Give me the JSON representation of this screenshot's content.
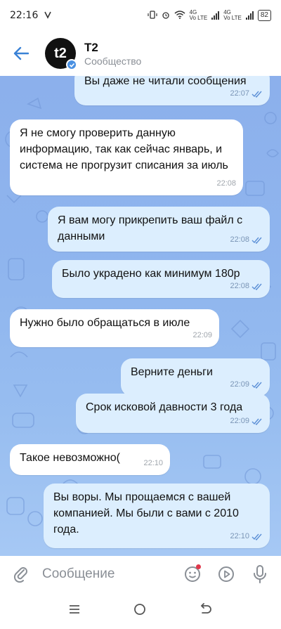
{
  "status_bar": {
    "time": "22:16",
    "net1": "Vo LTE",
    "net1_type": "4G",
    "net2": "Vo LTE",
    "net2_type": "4G",
    "battery": "82"
  },
  "header": {
    "title": "T2",
    "subtitle": "Сообщество",
    "avatar_text": "t2"
  },
  "messages": [
    {
      "dir": "out",
      "text": "Вы даже не читали сообщения",
      "time": "22:07"
    },
    {
      "dir": "in",
      "text": "Я не смогу проверить данную информацию, так как сейчас январь, и система не прогрузит списания за июль",
      "time": "22:08"
    },
    {
      "dir": "out",
      "text": "Я вам могу прикрепить ваш файл с данными",
      "time": "22:08"
    },
    {
      "dir": "out",
      "text": "Было украдено как минимум 180р",
      "time": "22:08"
    },
    {
      "dir": "in",
      "text": "Нужно было обращаться в июле",
      "time": "22:09"
    },
    {
      "dir": "out",
      "text": "Верните деньги",
      "time": "22:09"
    },
    {
      "dir": "out",
      "text": "Срок исковой давности 3 года",
      "time": "22:09"
    },
    {
      "dir": "in",
      "text": "Такое невозможно(",
      "time": "22:10"
    },
    {
      "dir": "out",
      "text": "Вы воры. Мы прощаемся с вашей компанией. Мы были с вами с 2010 года.",
      "time": "22:10"
    }
  ],
  "composer": {
    "placeholder": "Сообщение"
  },
  "colors": {
    "outgoing_bubble": "#dceefe",
    "incoming_bubble": "#ffffff",
    "accent": "#3a82d6",
    "chat_background": "#8fb5ee"
  },
  "icons": [
    "back-arrow-icon",
    "verified-badge-icon",
    "attach-paperclip-icon",
    "sticker-emoji-icon",
    "play-circle-icon",
    "microphone-icon",
    "recent-apps-icon",
    "home-circle-icon",
    "back-nav-icon"
  ]
}
